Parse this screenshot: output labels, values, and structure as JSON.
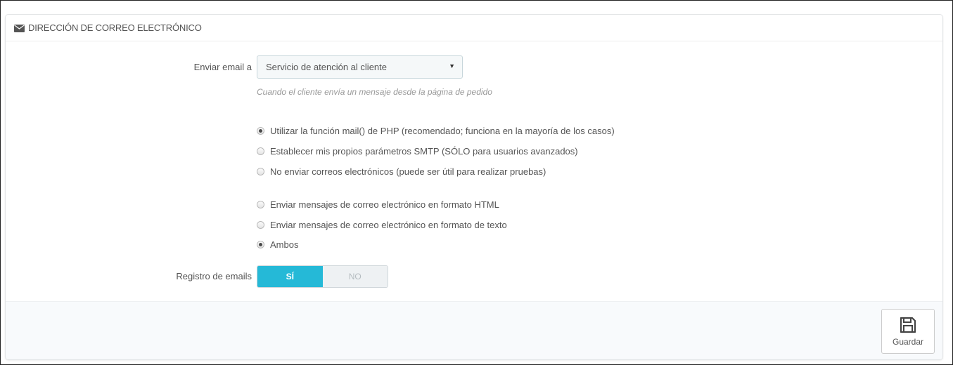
{
  "panel": {
    "title": "DIRECCIÓN DE CORREO ELECTRÓNICO",
    "title_icon": "envelope-icon"
  },
  "send_email": {
    "label": "Enviar email a",
    "selected": "Servicio de atención al cliente",
    "help": "Cuando el cliente envía un mensaje desde la página de pedido"
  },
  "mail_method": {
    "options": [
      {
        "label": "Utilizar la función mail() de PHP (recomendado; funciona en la mayoría de los casos)",
        "checked": true
      },
      {
        "label": "Establecer mis propios parámetros SMTP (SÓLO para usuarios avanzados)",
        "checked": false
      },
      {
        "label": "No enviar correos electrónicos (puede ser útil para realizar pruebas)",
        "checked": false
      }
    ]
  },
  "mail_format": {
    "options": [
      {
        "label": "Enviar mensajes de correo electrónico en formato HTML",
        "checked": false
      },
      {
        "label": "Enviar mensajes de correo electrónico en formato de texto",
        "checked": false
      },
      {
        "label": "Ambos",
        "checked": true
      }
    ]
  },
  "email_log": {
    "label": "Registro de emails",
    "yes": "SÍ",
    "no": "NO",
    "value": "SÍ"
  },
  "footer": {
    "save_label": "Guardar",
    "save_icon": "floppy-disk-icon"
  },
  "colors": {
    "accent": "#25b9d7"
  }
}
